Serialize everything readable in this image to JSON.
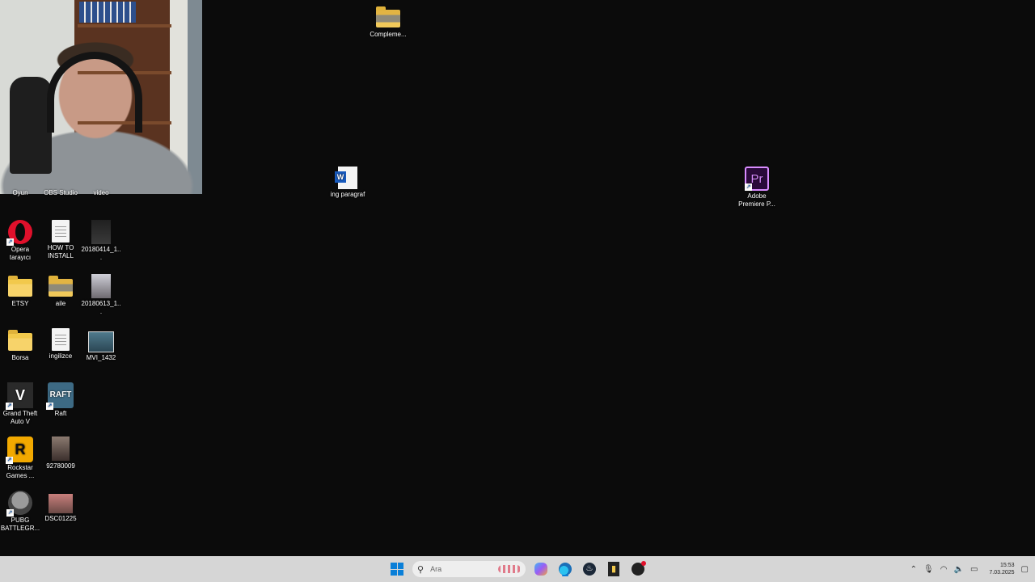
{
  "desktop": {
    "icons": [
      {
        "id": "oyun",
        "label": "Oyun"
      },
      {
        "id": "obs",
        "label": "OBS Studio"
      },
      {
        "id": "video",
        "label": "video"
      },
      {
        "id": "opera",
        "label": "Opera tarayıcı"
      },
      {
        "id": "howto",
        "label": "HOW TO INSTALL"
      },
      {
        "id": "img1",
        "label": "20180414_1..."
      },
      {
        "id": "etsy",
        "label": "ETSY"
      },
      {
        "id": "aile",
        "label": "aile"
      },
      {
        "id": "img2",
        "label": "20180613_1..."
      },
      {
        "id": "borsa",
        "label": "Borsa"
      },
      {
        "id": "ingilizce",
        "label": "ingilizce"
      },
      {
        "id": "mvi",
        "label": "MVI_1432"
      },
      {
        "id": "gta",
        "label": "Grand Theft Auto V"
      },
      {
        "id": "raft",
        "label": "Raft"
      },
      {
        "id": "rockstar",
        "label": "Rockstar Games ..."
      },
      {
        "id": "num",
        "label": "92780009"
      },
      {
        "id": "pubg",
        "label": "PUBG BATTLEGR..."
      },
      {
        "id": "dsc",
        "label": "DSC01225"
      },
      {
        "id": "compleme",
        "label": "Compleme..."
      },
      {
        "id": "ingparagraf",
        "label": "ing paragraf"
      },
      {
        "id": "premiere",
        "label": "Adobe Premiere P..."
      }
    ],
    "glyph_text": {
      "gta": "V",
      "raft": "RAFT",
      "rockstar": "R",
      "premiere": "Pr"
    }
  },
  "taskbar": {
    "search_placeholder": "Ara",
    "pinned": [
      {
        "id": "start",
        "icon": "windows-start-icon"
      },
      {
        "id": "copilot",
        "icon": "copilot-icon"
      },
      {
        "id": "edge",
        "icon": "edge-browser-icon"
      },
      {
        "id": "steam",
        "icon": "steam-icon"
      },
      {
        "id": "files",
        "icon": "file-explorer-icon"
      },
      {
        "id": "obs",
        "icon": "obs-studio-icon"
      }
    ],
    "tray": {
      "clock_time": "15:53",
      "clock_date": "7.03.2025"
    }
  },
  "colors": {
    "desktop_bg": "#0b0b0b",
    "taskbar_bg": "#d6d6d6",
    "accent": "#0a7fd8"
  }
}
